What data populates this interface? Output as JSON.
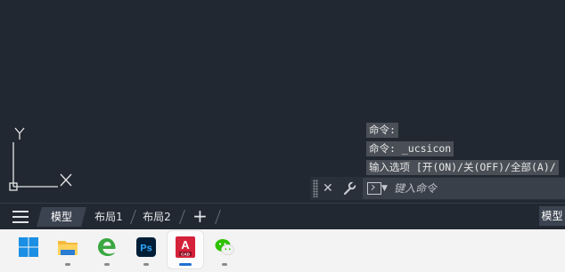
{
  "canvas": {
    "background": "#212831",
    "ucs_x_label": "X",
    "ucs_y_label": "Y"
  },
  "command_history": [
    "命令:",
    "命令: _ucsicon",
    "输入选项 [开(ON)/关(OFF)/全部(A)/"
  ],
  "command_bar": {
    "close_icon": "close-icon",
    "customize_icon": "wrench-icon",
    "placeholder": "键入命令"
  },
  "layout_tabs": {
    "menu_icon": "hamburger-icon",
    "tabs": [
      {
        "label": "模型",
        "active": true
      },
      {
        "label": "布局1",
        "active": false
      },
      {
        "label": "布局2",
        "active": false
      }
    ],
    "add_icon": "plus-icon"
  },
  "status_bar": {
    "model_label": "模型"
  },
  "taskbar": {
    "apps": [
      {
        "name": "start-button",
        "icon": "windows-logo-icon",
        "running": false
      },
      {
        "name": "file-explorer",
        "icon": "folder-icon",
        "running": true
      },
      {
        "name": "browser",
        "icon": "edge-legacy-icon",
        "running": true
      },
      {
        "name": "photoshop",
        "icon": "photoshop-icon",
        "label": "Ps",
        "running": true
      },
      {
        "name": "autocad",
        "icon": "autocad-icon",
        "label": "A",
        "sublabel": "CAD",
        "running": true,
        "active": true
      },
      {
        "name": "wechat",
        "icon": "wechat-icon",
        "running": true
      }
    ]
  },
  "colors": {
    "accent_blue": "#1f6fd1",
    "autocad_red": "#d5213a",
    "photoshop_bg": "#001e36",
    "photoshop_fg": "#31a8ff",
    "wechat_green": "#2dc100"
  }
}
